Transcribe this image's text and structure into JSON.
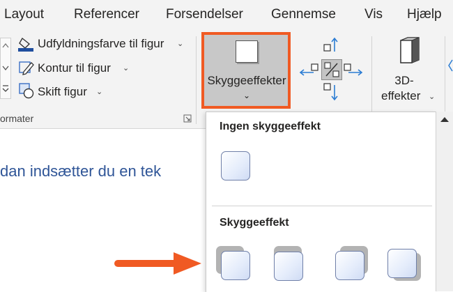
{
  "tabs": [
    "Layout",
    "Referencer",
    "Forsendelser",
    "Gennemse",
    "Vis",
    "Hjælp"
  ],
  "ribbon": {
    "fill_label": "Udfyldningsfarve til figur",
    "outline_label": "Kontur til figur",
    "change_shape_label": "Skift figur",
    "group_label": "ormater",
    "shadow_button_label": "Skyggeeffekter",
    "threed_line1": "3D-",
    "threed_line2": "effekter"
  },
  "document": {
    "text": "dan indsætter du en tek"
  },
  "gallery": {
    "no_shadow_heading": "Ingen skyggeeffekt",
    "shadow_heading": "Skyggeeffekt"
  },
  "colors": {
    "highlight": "#f05a23",
    "fill_bar": "#1f4e9e",
    "link_text": "#2f5597"
  },
  "icons": {
    "dropdown": "chevron-down-icon",
    "callout": "orange-arrow-icon"
  }
}
